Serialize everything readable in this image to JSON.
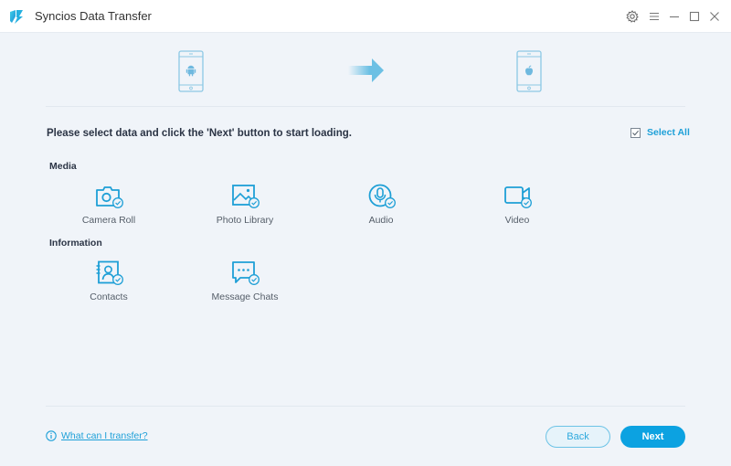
{
  "window": {
    "title": "Syncios Data Transfer",
    "controls": [
      "settings-icon",
      "menu-icon",
      "minimize-icon",
      "maximize-icon",
      "close-icon"
    ]
  },
  "devices": {
    "source": "android-phone-icon",
    "direction": "arrow-right-icon",
    "target": "apple-phone-icon"
  },
  "instruction": "Please select data and click the 'Next' button to start loading.",
  "select_all": {
    "label": "Select All",
    "checked": true
  },
  "sections": [
    {
      "label": "Media",
      "items": [
        {
          "label": "Camera Roll",
          "icon": "camera-icon",
          "checked": true
        },
        {
          "label": "Photo Library",
          "icon": "photo-icon",
          "checked": true
        },
        {
          "label": "Audio",
          "icon": "microphone-icon",
          "checked": true
        },
        {
          "label": "Video",
          "icon": "video-camera-icon",
          "checked": true
        }
      ]
    },
    {
      "label": "Information",
      "items": [
        {
          "label": "Contacts",
          "icon": "contacts-book-icon",
          "checked": true
        },
        {
          "label": "Message Chats",
          "icon": "chat-bubble-icon",
          "checked": true
        }
      ]
    }
  ],
  "footer": {
    "help_link": "What can I transfer?",
    "back_label": "Back",
    "next_label": "Next"
  },
  "colors": {
    "accent": "#1ea0d8",
    "primary_button": "#0ca2e1",
    "background": "#f0f4f9"
  }
}
